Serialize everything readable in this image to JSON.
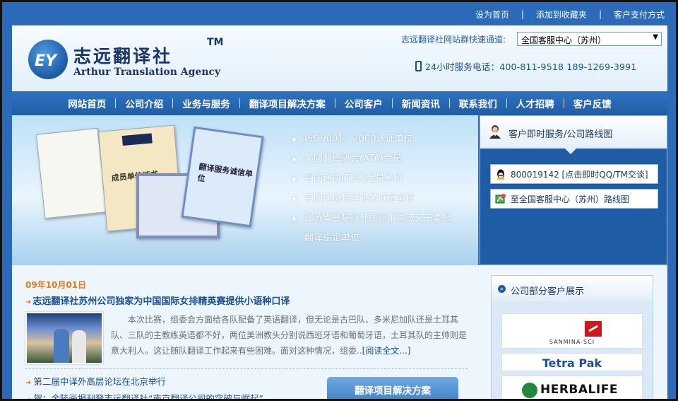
{
  "colors": {
    "brand_blue": "#2a6ab8",
    "nav_blue": "#1f5ca6",
    "link_blue": "#1b4f8f",
    "accent_orange": "#e07a1f",
    "body_gray": "#6a6f78"
  },
  "toplinks": {
    "home": "设为首页",
    "favorite": "添加到收藏夹",
    "payment": "客户支付方式",
    "separator": "|"
  },
  "header": {
    "logo_cn": "志远翻译社",
    "logo_tm": "TM",
    "logo_en": "Arthur Translation Agency",
    "logo_icon": "ey-globe-icon",
    "quick_label": "志远翻译社网站群快速通道:",
    "quick_select_value": "全国客服中心（苏州）",
    "phone_icon": "mobile-phone-icon",
    "phone_text": "24小时服务电话：400-811-9518  189-1269-3991"
  },
  "nav": {
    "items": [
      {
        "label": "网站首页"
      },
      {
        "label": "公司介绍"
      },
      {
        "label": "业务与服务"
      },
      {
        "label": "翻译项目解决方案"
      },
      {
        "label": "公司客户"
      },
      {
        "label": "新闻资讯"
      },
      {
        "label": "联系我们"
      },
      {
        "label": "人才招聘"
      },
      {
        "label": "客户反馈"
      }
    ]
  },
  "banner": {
    "certificates": {
      "tsc_cert_title": "成员单位证书",
      "right_cert_title": "翻译服务诚信单位"
    },
    "items": [
      "ISO9001：2000认证单位",
      "美国翻译协会(ATA)会员",
      "中国译协(TSC)会员单位",
      "中国译协翻译服务诚信单位",
      "江苏省高院涉外民商事司法文书委托",
      "翻译指定单位"
    ]
  },
  "service": {
    "title": "客户即时服务/公司路线图",
    "qq_button": "800019142 [点击即时QQ/TM交谈]",
    "route_button": "至全国客服中心（苏州）路线图",
    "person_icon": "customer-service-icon",
    "qq_icon": "qq-penguin-icon",
    "route_icon": "map-route-icon"
  },
  "news": {
    "date": "09年10月01日",
    "title": "志远翻译社苏州公司独家为中国国际女排精英赛提供小语种口译",
    "body": "本次比赛，组委会方面给各队配备了英语翻译，但无论是古巴队、多米尼加队还是土耳其队、三队的主教练英语都不好，两位美洲教头分别说西班牙语和葡萄牙语，土耳其队的主帅则是意大利人。这让随队翻译工作起来有些困难。面对这种情况，组委..",
    "more": "[阅读全文...]",
    "list": [
      "第二届中译外高层论坛在北京举行",
      "贺：金陵画报刊登志远翻译社“南京翻译公司的突破与崛起”"
    ],
    "solution_button": "翻译项目解决方案"
  },
  "clients": {
    "title": "公司部分客户展示",
    "logos": [
      "SANMINA-SCI",
      "Tetra Pak",
      "HERBALIFE"
    ]
  }
}
